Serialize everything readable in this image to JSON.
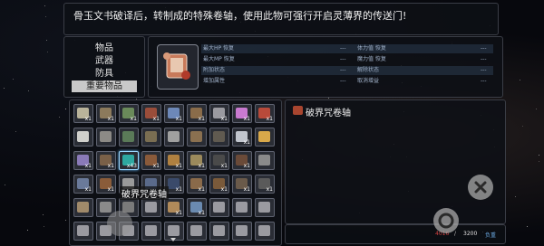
{
  "description_text": "骨玉文书破译后，转制成的特殊卷轴，使用此物可强行开启灵薄界的传送门!",
  "categories": [
    {
      "label": "物品",
      "selected": false
    },
    {
      "label": "武器",
      "selected": false
    },
    {
      "label": "防具",
      "selected": false
    },
    {
      "label": "重要物品",
      "selected": true
    }
  ],
  "stats": [
    {
      "left": "最大HP 恢复",
      "sep1": "---",
      "right": "体力值 恢复",
      "sep2": "---"
    },
    {
      "left": "最大MP 恢复",
      "sep1": "---",
      "right": "魔力值 恢复",
      "sep2": "---"
    },
    {
      "left": "附加状态",
      "sep1": "---",
      "right": "解除状态",
      "sep2": "---"
    },
    {
      "left": "增加属性",
      "sep1": "---",
      "right": "取消增益",
      "sep2": "---"
    }
  ],
  "item_grid": [
    [
      {
        "c": "#b9b39a",
        "n": "x1"
      },
      {
        "c": "#8c7a5c",
        "n": "x1"
      },
      {
        "c": "#6a8a5a",
        "n": "x1"
      },
      {
        "c": "#9a4d3a",
        "n": "x1"
      },
      {
        "c": "#6d88b8",
        "n": "x1"
      },
      {
        "c": "#8a6c4a",
        "n": "x1"
      },
      {
        "c": "#9a9aa0",
        "n": "x1"
      },
      {
        "c": "#c97ad0",
        "n": "x1"
      },
      {
        "c": "#b84a3a",
        "n": "x1"
      }
    ],
    [
      {
        "c": "#d0d0cc",
        "n": ""
      },
      {
        "c": "#8c8a86",
        "n": ""
      },
      {
        "c": "#5a7a58",
        "n": ""
      },
      {
        "c": "#7a6e52",
        "n": ""
      },
      {
        "c": "#a0a0a0",
        "n": ""
      },
      {
        "c": "#8a7050",
        "n": ""
      },
      {
        "c": "#605a50",
        "n": ""
      },
      {
        "c": "#c2c6ce",
        "n": "x1"
      },
      {
        "c": "#d8a84a",
        "n": ""
      }
    ],
    [
      {
        "c": "#8a7ab8",
        "n": "x1"
      },
      {
        "c": "#7a6048",
        "n": "x1"
      },
      {
        "c": "#2ea8a0",
        "n": "x43",
        "sel": true
      },
      {
        "c": "#8a5a3a",
        "n": "x1"
      },
      {
        "c": "#b08040",
        "n": "x1"
      },
      {
        "c": "#9c8a5c",
        "n": "x1"
      },
      {
        "c": "#4a4a4a",
        "n": "x1"
      },
      {
        "c": "#6a4a38",
        "n": "x1"
      },
      {
        "c": "#8a8a8a",
        "n": ""
      }
    ],
    [
      {
        "c": "#6a7a9a",
        "n": "x1"
      },
      {
        "c": "#8a5c3a",
        "n": "x1"
      },
      {
        "c": "#9a9a9a",
        "n": ""
      },
      {
        "c": "#5a6a8a",
        "n": ""
      },
      {
        "c": "#3a4a6a",
        "n": "x1"
      },
      {
        "c": "#8a6a4a",
        "n": "x1"
      },
      {
        "c": "#7a5a3a",
        "n": "x1"
      },
      {
        "c": "#6a5a4a",
        "n": "x1"
      },
      {
        "c": "#5a5a5a",
        "n": "x1"
      }
    ],
    [
      {
        "c": "#a08a6a",
        "n": ""
      },
      {
        "c": "#8a8a8a",
        "n": ""
      },
      {
        "c": "#7a7a7a",
        "n": ""
      },
      {
        "c": "#9a9aa0",
        "n": ""
      },
      {
        "c": "#b08a5a",
        "n": "x1"
      },
      {
        "c": "#6a8ab0",
        "n": "x1"
      },
      {
        "c": "#9a9aa0",
        "n": ""
      },
      {
        "c": "#9a9aa0",
        "n": ""
      },
      {
        "c": "#9a9aa0",
        "n": ""
      }
    ],
    [
      {
        "c": "#9a9aa0",
        "n": ""
      },
      {
        "c": "#9a9aa0",
        "n": ""
      },
      {
        "c": "#9a9aa0",
        "n": ""
      },
      {
        "c": "#9a9aa0",
        "n": ""
      },
      {
        "c": "#9a9aa0",
        "n": ""
      },
      {
        "c": "#9a9aa0",
        "n": ""
      },
      {
        "c": "#9a9aa0",
        "n": ""
      },
      {
        "c": "#9a9aa0",
        "n": ""
      },
      {
        "c": "#9a9aa0",
        "n": ""
      }
    ]
  ],
  "tooltip": "破界咒卷轴",
  "selected_item_name": "破界咒卷轴",
  "footer": {
    "current": "4016",
    "sep": "/",
    "max": "3200",
    "label": "负重"
  }
}
